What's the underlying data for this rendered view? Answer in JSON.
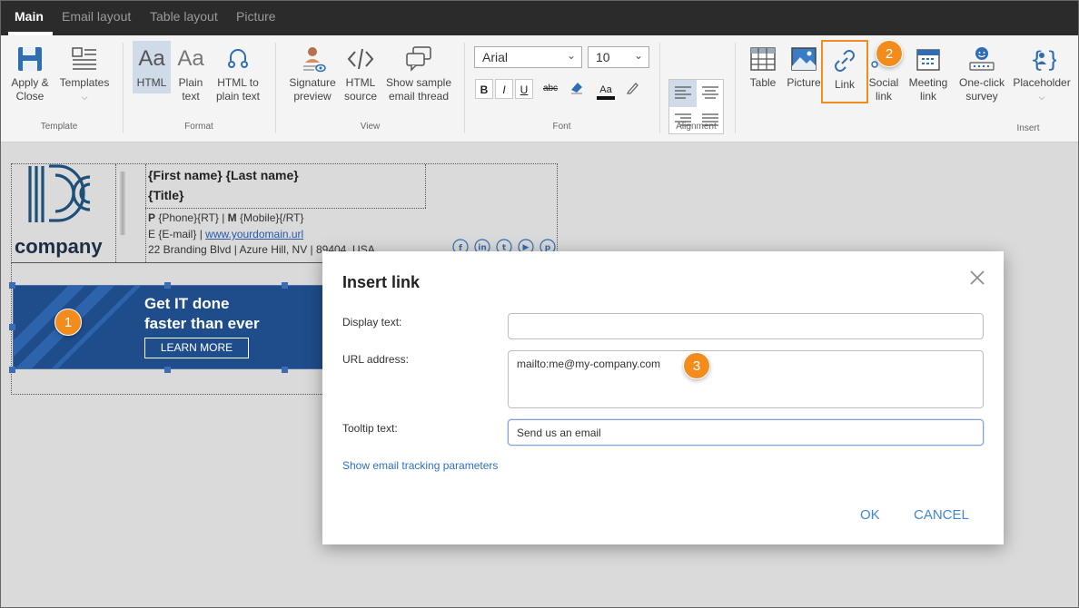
{
  "tabs": [
    {
      "label": "Main",
      "active": true
    },
    {
      "label": "Email layout",
      "active": false
    },
    {
      "label": "Table layout",
      "active": false
    },
    {
      "label": "Picture",
      "active": false
    }
  ],
  "ribbon": {
    "template": {
      "apply_close": [
        "Apply &",
        "Close"
      ],
      "templates": "Templates",
      "group": "Template"
    },
    "format": {
      "html": "HTML",
      "plain_text": [
        "Plain",
        "text"
      ],
      "html_to_plain": [
        "HTML to",
        "plain text"
      ],
      "group": "Format"
    },
    "view": {
      "signature_preview": [
        "Signature",
        "preview"
      ],
      "html_source": [
        "HTML",
        "source"
      ],
      "sample_thread": [
        "Show sample",
        "email thread"
      ],
      "group": "View"
    },
    "font": {
      "family": "Arial",
      "size": "10",
      "bold": "B",
      "italic": "I",
      "underline": "U",
      "strike": "abc",
      "color_sample": "Aa",
      "group": "Font"
    },
    "alignment": {
      "group": "Alignment"
    },
    "insert": {
      "table": "Table",
      "picture": "Picture",
      "link": "Link",
      "social_link": [
        "Social",
        "link"
      ],
      "meeting_link": [
        "Meeting",
        "link"
      ],
      "survey": [
        "One-click",
        "survey"
      ],
      "placeholder": "Placeholder",
      "group": "Insert"
    }
  },
  "signature": {
    "logo_text": "company",
    "name": "{First name} {Last name}",
    "title": "{Title}",
    "phone_prefix": "P",
    "phone_value": "{Phone}{RT} |",
    "mobile_prefix": "M",
    "mobile_value": "{Mobile}{/RT}",
    "email_prefix": "E {E-mail} |",
    "website": "www.yourdomain.url",
    "address": "22 Branding Blvd | Azure Hill, NV | 89404, USA",
    "social_icons": [
      "facebook-icon",
      "linkedin-icon",
      "twitter-icon",
      "youtube-icon",
      "pinterest-icon"
    ]
  },
  "banner": {
    "headline1": "Get IT done",
    "headline2": "faster than ever",
    "cta": "LEARN MORE",
    "color": "#1f4d8c"
  },
  "callouts": [
    "1",
    "2",
    "3"
  ],
  "dialog": {
    "title": "Insert link",
    "display_text_label": "Display text:",
    "display_text_value": "",
    "url_label": "URL address:",
    "url_value": "mailto:me@my-company.com",
    "tooltip_label": "Tooltip text:",
    "tooltip_value": "Send us an email",
    "tracking_link": "Show email tracking parameters",
    "ok": "OK",
    "cancel": "CANCEL"
  },
  "colors": {
    "accent": "#3f86d6",
    "highlight": "#f28c1c",
    "tabbar": "#2b2b2b"
  }
}
